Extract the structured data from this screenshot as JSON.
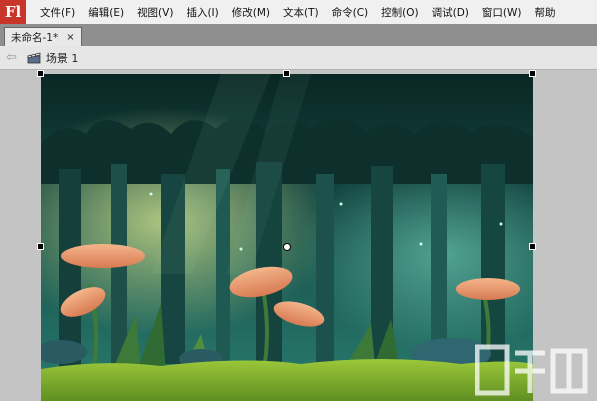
{
  "app": {
    "logo": "Fl"
  },
  "menu": [
    "文件(F)",
    "编辑(E)",
    "视图(V)",
    "插入(I)",
    "修改(M)",
    "文本(T)",
    "命令(C)",
    "控制(O)",
    "调试(D)",
    "窗口(W)",
    "帮助"
  ],
  "document_tab": {
    "title": "未命名-1*",
    "close": "×"
  },
  "scene": {
    "back_icon": "back-arrow-icon",
    "icon": "scene-clapper-icon",
    "label": "场景 1"
  },
  "watermark": {
    "text": "系统吧"
  },
  "colors": {
    "app_logo": "#c8352b",
    "menubar": "#f0f0f0",
    "tabbar": "#8f8f8f",
    "stage_bg": "#0d2a2a"
  }
}
